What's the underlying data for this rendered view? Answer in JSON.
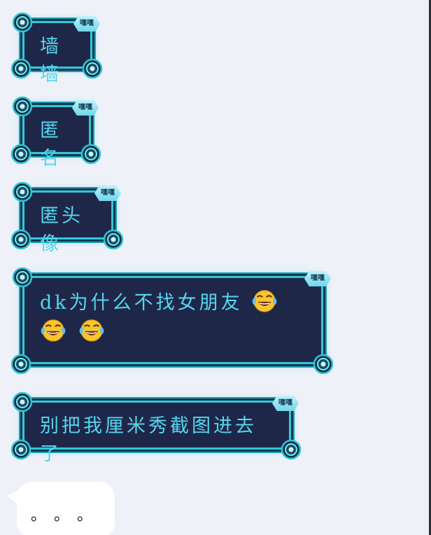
{
  "colors": {
    "background": "#eef1f8",
    "bubble_fill": "#1f2749",
    "bubble_border": "#33c7d8",
    "bubble_text": "#55d6ee",
    "tag_fill": "#9fe6f4",
    "plain_bubble": "#ffffff"
  },
  "messages": [
    {
      "text": "墙墙",
      "tag": "嘿嘿",
      "emoji_count": 0
    },
    {
      "text": "匿名",
      "tag": "嘿嘿",
      "emoji_count": 0
    },
    {
      "text": "匿头像",
      "tag": "嘿嘿",
      "emoji_count": 0
    },
    {
      "text": "dk为什么不找女朋友",
      "tag": "嘿嘿",
      "emoji": "tears-of-joy",
      "emoji_count": 3
    },
    {
      "text": "别把我厘米秀截图进去了",
      "tag": "嘿嘿",
      "emoji_count": 0
    }
  ],
  "last_message": {
    "text": "。。。"
  }
}
